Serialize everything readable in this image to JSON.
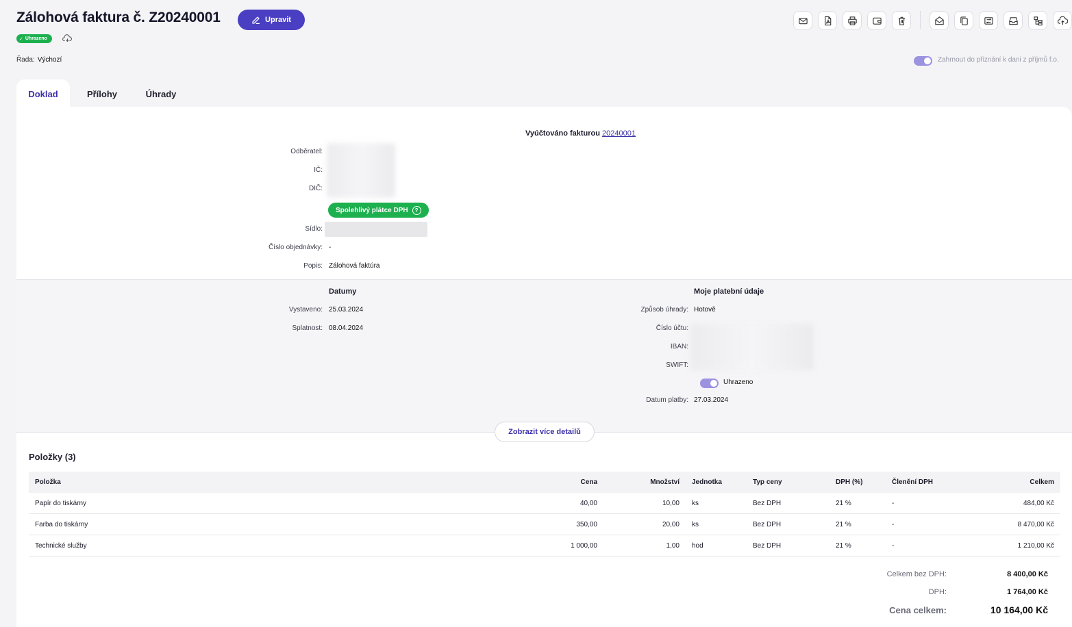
{
  "header": {
    "title": "Zálohová faktura č. Z20240001",
    "edit_label": "Upravit",
    "status_badge": "Uhrazeno",
    "series_label": "Řada:",
    "series_value": "Výchozí",
    "tax_toggle_label": "Zahrnout do přiznání k dani z příjmů f.o."
  },
  "toolbar": {
    "icons": [
      "mail-icon",
      "pdf-icon",
      "print-icon",
      "wallet-icon",
      "trash-icon",
      "open-mail-icon",
      "copy-icon",
      "exchange-icon",
      "archive-icon",
      "structure-icon",
      "cloud-sync-icon"
    ]
  },
  "tabs": [
    {
      "label": "Doklad",
      "active": true
    },
    {
      "label": "Přílohy",
      "active": false
    },
    {
      "label": "Úhrady",
      "active": false
    }
  ],
  "invoice": {
    "billed_by_text": "Vyúčtováno fakturou",
    "billed_by_number": "20240001",
    "customer_label": "Odběratel:",
    "ic_label": "IČ:",
    "dic_label": "DIČ:",
    "reliable_payer": "Spolehlivý plátce DPH",
    "seat_label": "Sídlo:",
    "order_label": "Číslo objednávky:",
    "order_value": "-",
    "description_label": "Popis:",
    "description_value": "Zálohová faktúra"
  },
  "dates": {
    "heading": "Datumy",
    "issued_label": "Vystaveno:",
    "issued_value": "25.03.2024",
    "due_label": "Splatnost:",
    "due_value": "08.04.2024"
  },
  "payment": {
    "heading": "Moje platební údaje",
    "method_label": "Způsob úhrady:",
    "method_value": "Hotově",
    "account_label": "Číslo účtu:",
    "iban_label": "IBAN:",
    "swift_label": "SWIFT:",
    "paid_toggle_label": "Uhrazeno",
    "paid_date_label": "Datum platby:",
    "paid_date_value": "27.03.2024"
  },
  "more_details_label": "Zobrazit více detailů",
  "items": {
    "title": "Položky (3)",
    "columns": [
      "Položka",
      "Cena",
      "Množství",
      "Jednotka",
      "Typ ceny",
      "DPH (%)",
      "Členění DPH",
      "Celkem"
    ],
    "rows": [
      [
        "Papír do tiskárny",
        "40,00",
        "10,00",
        "ks",
        "Bez DPH",
        "21 %",
        "-",
        "484,00 Kč"
      ],
      [
        "Farba do tiskárny",
        "350,00",
        "20,00",
        "ks",
        "Bez DPH",
        "21 %",
        "-",
        "8 470,00 Kč"
      ],
      [
        "Technické služby",
        "1 000,00",
        "1,00",
        "hod",
        "Bez DPH",
        "21 %",
        "-",
        "1 210,00 Kč"
      ]
    ]
  },
  "totals": {
    "net_label": "Celkem bez DPH:",
    "net_value": "8 400,00 Kč",
    "vat_label": "DPH:",
    "vat_value": "1 764,00 Kč",
    "total_label": "Cena celkem:",
    "total_value": "10 164,00 Kč"
  },
  "colors": {
    "accent": "#4a3fc2",
    "success": "#1cb04e",
    "background": "#f4f4f7"
  }
}
